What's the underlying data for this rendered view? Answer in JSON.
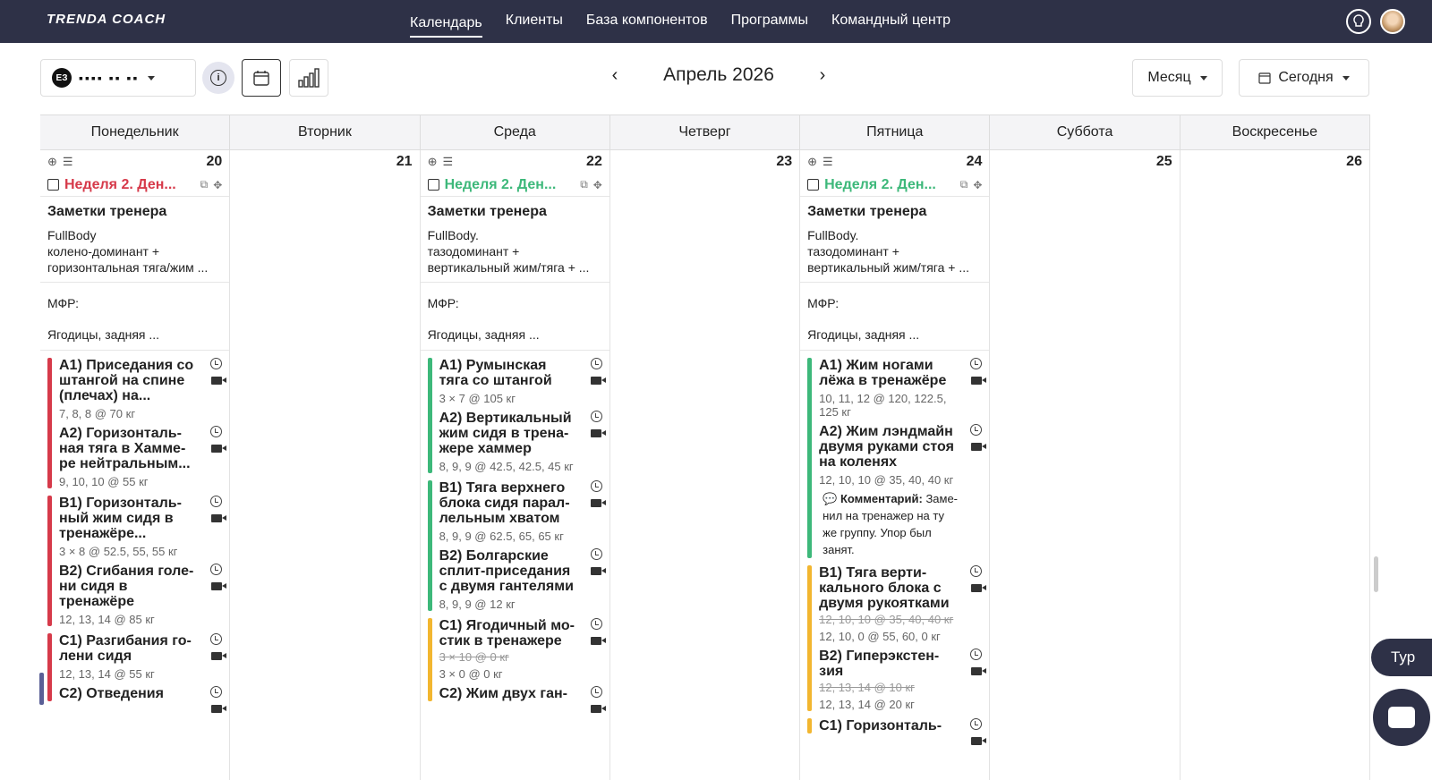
{
  "brand": {
    "logo": "TRENDA COACH"
  },
  "nav": {
    "links": [
      "Календарь",
      "Клиенты",
      "База компонентов",
      "Программы",
      "Командный центр"
    ]
  },
  "toolbar": {
    "client_initials": "ЕЗ",
    "client_name_masked": "▪▪▪▪ ▪▪ ▪▪",
    "month_title": "Апрель 2026",
    "view_label": "Месяц",
    "today_label": "Сегодня"
  },
  "weekdays": [
    "Понедельник",
    "Вторник",
    "Среда",
    "Четверг",
    "Пятница",
    "Суббота",
    "Воскресенье"
  ],
  "days": [
    {
      "num": "20",
      "has_plan": true,
      "week_title": "Неделя 2. Ден...",
      "week_color": "#d63a4a",
      "notes_title": "Заметки тренера",
      "notes_lines": [
        "FullBody",
        "колено-доминант +",
        "горизонтальная тяга/жим ..."
      ],
      "mfr": "МФР:",
      "mfr_text": "Ягодицы, задняя ...",
      "groups": [
        {
          "color": "#d63a4a",
          "items": [
            {
              "name": "A1) Приседания со штангой на спине (плечах) на...",
              "res": "7, 8, 8 @ 70 кг"
            },
            {
              "name": "A2) Горизонталь-ная тяга в Хамме-ре нейтральным...",
              "res": "9, 10, 10 @ 55 кг"
            }
          ]
        },
        {
          "color": "#d63a4a",
          "items": [
            {
              "name": "B1) Горизонталь-ный жим сидя в тренажёре...",
              "res": "3 × 8 @ 52.5, 55, 55 кг"
            },
            {
              "name": "B2) Сгибания голе-ни сидя в тренажёре",
              "res": "12, 13, 14 @ 85 кг"
            }
          ]
        },
        {
          "color": "#d63a4a",
          "items": [
            {
              "name": "C1) Разгибания го-лени сидя",
              "res": "12, 13, 14 @ 55 кг"
            },
            {
              "name": "C2) Отведения",
              "res": ""
            }
          ]
        }
      ]
    },
    {
      "num": "21",
      "has_plan": false
    },
    {
      "num": "22",
      "has_plan": true,
      "week_title": "Неделя 2. Ден...",
      "week_color": "#3db87a",
      "notes_title": "Заметки тренера",
      "notes_lines": [
        "FullBody.",
        "тазодоминант +",
        "вертикальный жим/тяга + ..."
      ],
      "mfr": "МФР:",
      "mfr_text": "Ягодицы, задняя ...",
      "groups": [
        {
          "color": "#3db87a",
          "items": [
            {
              "name": "A1) Румынская тяга со штангой",
              "res": "3 × 7 @ 105 кг"
            },
            {
              "name": "A2) Вертикальный жим сидя в трена-жере хаммер",
              "res": "8, 9, 9 @ 42.5, 42.5, 45 кг"
            }
          ]
        },
        {
          "color": "#3db87a",
          "items": [
            {
              "name": "B1) Тяга верхнего блока сидя парал-лельным хватом",
              "res": "8, 9, 9 @ 62.5, 65, 65 кг"
            },
            {
              "name": "B2) Болгарские сплит-приседания с двумя гантелями",
              "res": "8, 9, 9 @ 12 кг"
            }
          ]
        },
        {
          "color": "#f2b630",
          "items": [
            {
              "name": "C1) Ягодичный мо-стик в тренажере",
              "old": "3 × 10 @ 0 кг",
              "res": "3 × 0 @ 0 кг"
            },
            {
              "name": "C2) Жим двух ган-",
              "res": ""
            }
          ]
        }
      ]
    },
    {
      "num": "23",
      "has_plan": false
    },
    {
      "num": "24",
      "has_plan": true,
      "week_title": "Неделя 2. Ден...",
      "week_color": "#3db87a",
      "notes_title": "Заметки тренера",
      "notes_lines": [
        "FullBody.",
        "тазодоминант +",
        "вертикальный жим/тяга + ..."
      ],
      "mfr": "МФР:",
      "mfr_text": "Ягодицы, задняя ...",
      "groups": [
        {
          "color": "#3db87a",
          "items": [
            {
              "name": "A1) Жим ногами лёжа в тренажёре",
              "res": "10, 11, 12 @ 120, 122.5, 125 кг"
            },
            {
              "name": "A2) Жим лэндмайн двумя руками стоя на коленях",
              "res": "12, 10, 10 @ 35, 40, 40 кг",
              "comment_label": "Комментарий:",
              "comment": "Заме-нил на тренажер на ту же группу. Упор был занят."
            }
          ]
        },
        {
          "color": "#f2b630",
          "items": [
            {
              "name": "B1) Тяга верти-кального блока с двумя рукоятками",
              "old": "12, 10, 10 @ 35, 40, 40 кг",
              "res": "12, 10, 0 @ 55, 60, 0 кг"
            },
            {
              "name": "B2) Гиперэкстен-зия",
              "old": "12, 13, 14 @ 10 кг",
              "res": "12, 13, 14 @ 20 кг"
            }
          ]
        },
        {
          "color": "#f2b630",
          "items": [
            {
              "name": "C1) Горизонталь-",
              "res": ""
            }
          ]
        }
      ]
    },
    {
      "num": "25",
      "has_plan": false
    },
    {
      "num": "26",
      "has_plan": false
    }
  ],
  "floating": {
    "tour_label": "Тур"
  },
  "colors": {
    "nav_bg": "#2e3147",
    "red": "#d63a4a",
    "green": "#3db87a",
    "yellow": "#f2b630"
  }
}
